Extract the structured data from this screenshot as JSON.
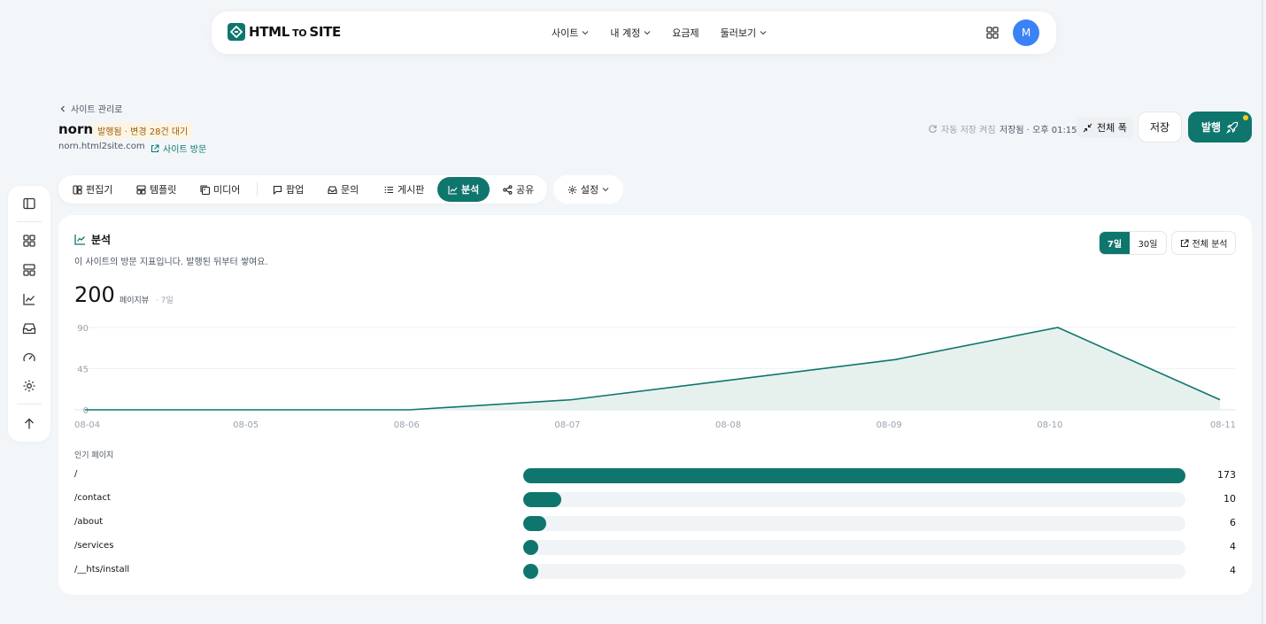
{
  "nav": {
    "logo_html": "HTML",
    "logo_to": "TO",
    "logo_site": "SITE",
    "links": [
      {
        "label": "사이트",
        "has_dropdown": true
      },
      {
        "label": "내 계정",
        "has_dropdown": true
      },
      {
        "label": "요금제",
        "has_dropdown": false
      },
      {
        "label": "둘러보기",
        "has_dropdown": true
      }
    ],
    "avatar_initial": "M",
    "avatar_color": "#3b82f6"
  },
  "header": {
    "back_label": "사이트 관리로",
    "site_name": "norn",
    "status_badge": "발행됨 · 변경 28건 대기",
    "domain": "norn.html2site.com",
    "visit_label": "사이트 방문",
    "autosave_label": "자동 저장 켜짐",
    "saved_at": "저장됨 · 오후 01:15",
    "fullwidth_label": "전체 폭",
    "save_label": "저장",
    "publish_label": "발행"
  },
  "tabs": [
    {
      "label": "편집기",
      "icon": "layout-icon",
      "active": false
    },
    {
      "label": "템플릿",
      "icon": "template-icon",
      "active": false
    },
    {
      "label": "미디어",
      "icon": "media-icon",
      "active": false
    },
    {
      "label": "팝업",
      "icon": "chat-icon",
      "active": false
    },
    {
      "label": "문의",
      "icon": "inbox-icon",
      "active": false
    },
    {
      "label": "게시판",
      "icon": "list-icon",
      "active": false
    },
    {
      "label": "분석",
      "icon": "chart-icon",
      "active": true
    },
    {
      "label": "공유",
      "icon": "share-icon",
      "active": false
    }
  ],
  "settings_label": "설정",
  "analytics": {
    "title": "분석",
    "subtitle": "이 사이트의 방문 지표입니다. 발행된 뒤부터 쌓여요.",
    "ranges": [
      "7일",
      "30일"
    ],
    "active_range": "7일",
    "full_label": "전체 분석",
    "total": "200",
    "total_label": "페이지뷰",
    "total_range": "· 7일",
    "popular_title": "인기 페이지",
    "pages": [
      {
        "path": "/",
        "count": 173
      },
      {
        "path": "/contact",
        "count": 10
      },
      {
        "path": "/about",
        "count": 6
      },
      {
        "path": "/services",
        "count": 4
      },
      {
        "path": "/__hts/install",
        "count": 4
      }
    ]
  },
  "chart_data": {
    "type": "area",
    "x": [
      "08-04",
      "08-05",
      "08-06",
      "08-07",
      "08-08",
      "08-09",
      "08-10",
      "08-11"
    ],
    "values": [
      0,
      0,
      0,
      11,
      33,
      55,
      90,
      11
    ],
    "yticks": [
      0,
      45,
      90
    ],
    "ylim": [
      0,
      90
    ],
    "grid": true,
    "line_color": "#0f766e",
    "fill_color": "#e3efec"
  },
  "colors": {
    "accent": "#0f766e",
    "badge_bg": "#fdf5e4",
    "badge_text": "#9a5b0c"
  }
}
